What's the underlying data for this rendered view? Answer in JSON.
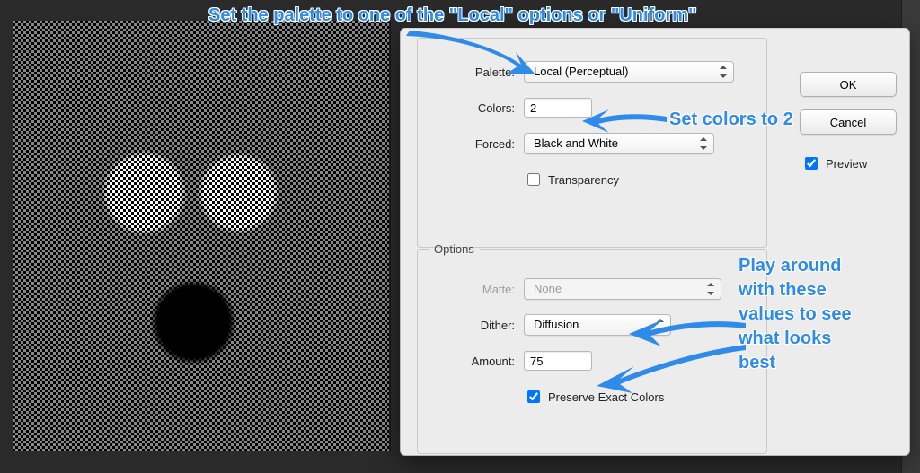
{
  "annotations": {
    "top": "Set the palette to one of the \"Local\" options or \"Uniform\"",
    "colors": "Set colors to 2",
    "options": "Play around\nwith these\nvalues to see\nwhat looks\nbest"
  },
  "dialog": {
    "palette_group": {
      "palette_label": "Palette:",
      "palette_value": "Local (Perceptual)",
      "colors_label": "Colors:",
      "colors_value": "2",
      "forced_label": "Forced:",
      "forced_value": "Black and White",
      "transparency_label": "Transparency",
      "transparency_checked": false
    },
    "options_group": {
      "legend": "Options",
      "matte_label": "Matte:",
      "matte_value": "None",
      "matte_enabled": false,
      "dither_label": "Dither:",
      "dither_value": "Diffusion",
      "amount_label": "Amount:",
      "amount_value": "75",
      "preserve_label": "Preserve Exact Colors",
      "preserve_checked": true
    },
    "buttons": {
      "ok": "OK",
      "cancel": "Cancel",
      "preview_label": "Preview",
      "preview_checked": true
    }
  }
}
